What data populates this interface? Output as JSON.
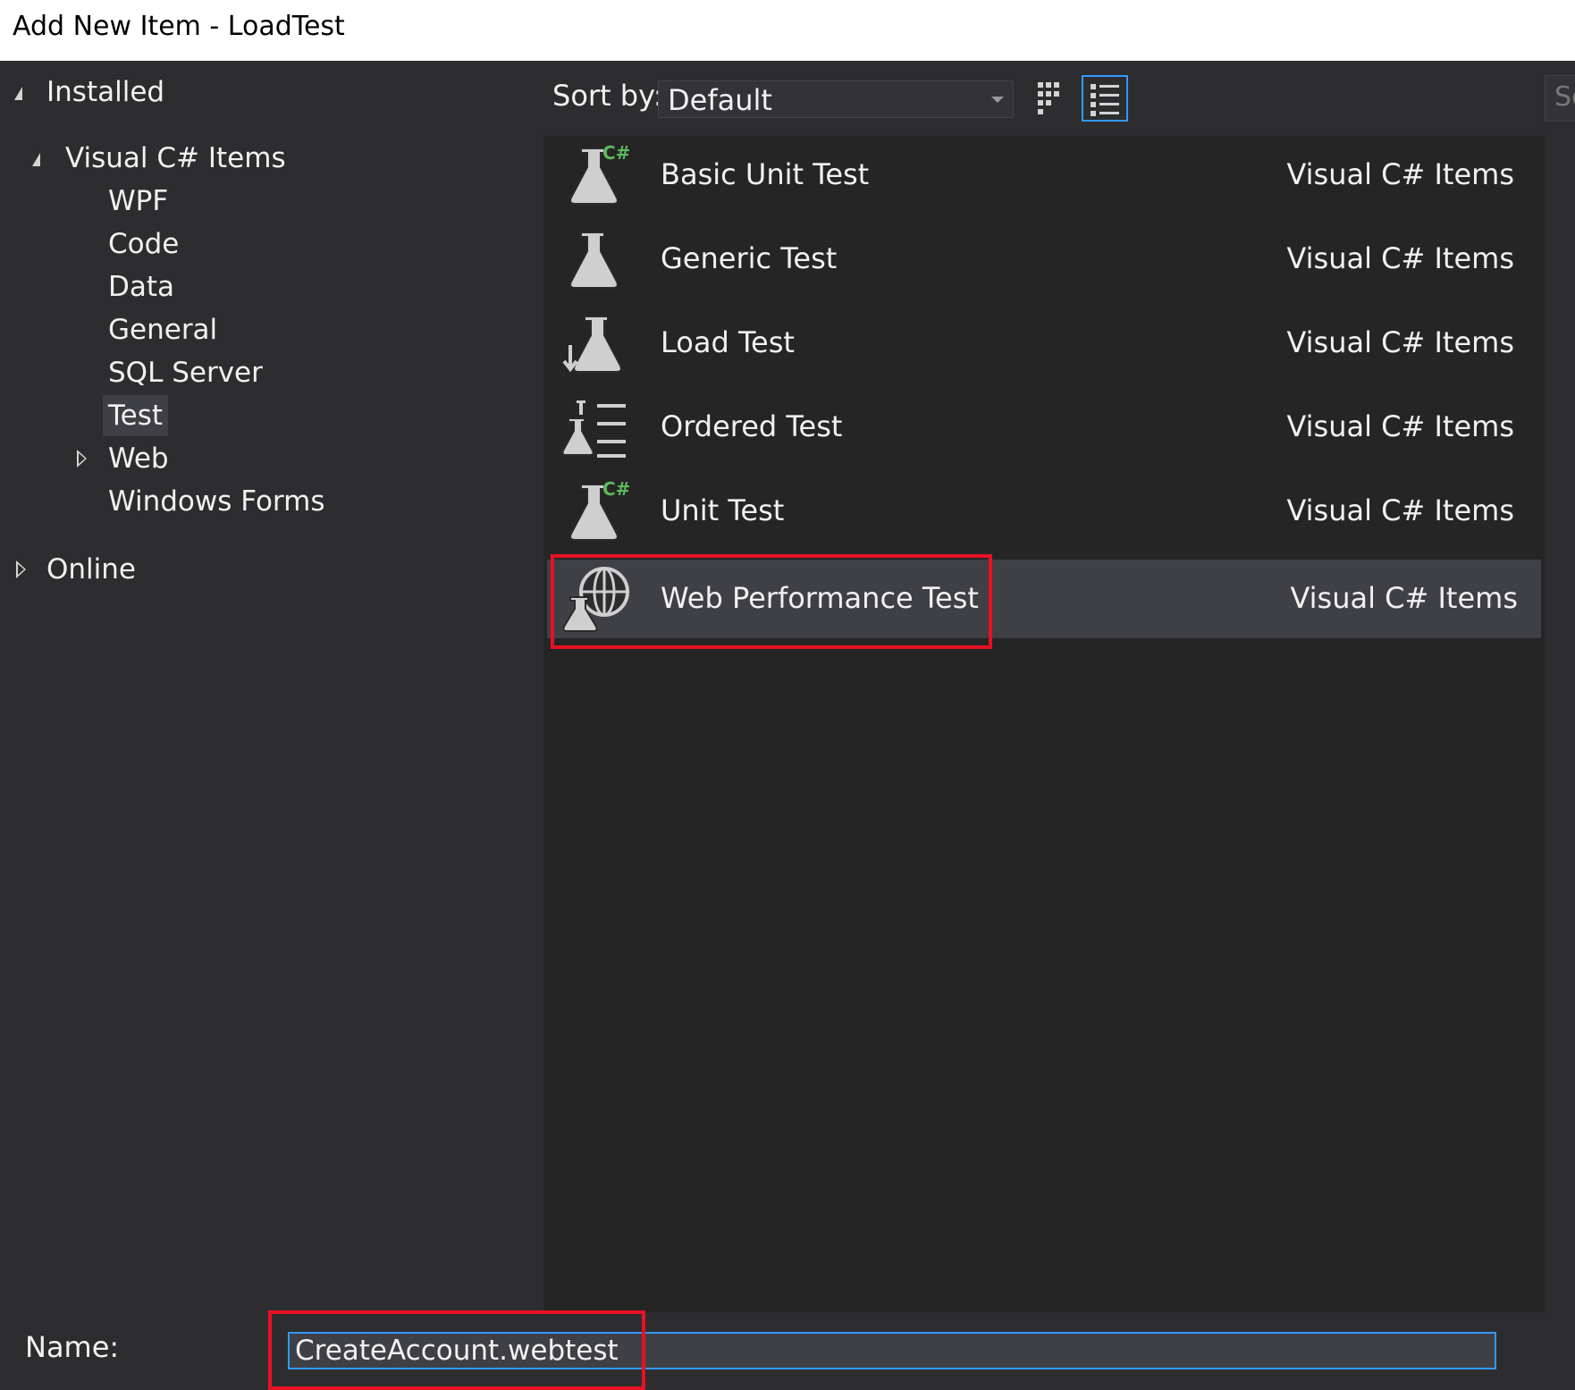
{
  "window": {
    "title": "Add New Item - LoadTest"
  },
  "tree": {
    "installed": "Installed",
    "visual_csharp": "Visual C# Items",
    "children": [
      "WPF",
      "Code",
      "Data",
      "General",
      "SQL Server",
      "Test",
      "Web",
      "Windows Forms"
    ],
    "selected": "Test",
    "online": "Online"
  },
  "toolbar": {
    "sort_label": "Sort by:",
    "sort_value": "Default",
    "search_partial": "Se"
  },
  "templates": [
    {
      "name": "Basic Unit Test",
      "category": "Visual C# Items",
      "icon": "flask-csharp-icon"
    },
    {
      "name": "Generic Test",
      "category": "Visual C# Items",
      "icon": "flask-icon"
    },
    {
      "name": "Load Test",
      "category": "Visual C# Items",
      "icon": "flask-load-icon"
    },
    {
      "name": "Ordered Test",
      "category": "Visual C# Items",
      "icon": "flask-ordered-icon"
    },
    {
      "name": "Unit Test",
      "category": "Visual C# Items",
      "icon": "flask-csharp-icon"
    },
    {
      "name": "Web Performance Test",
      "category": "Visual C# Items",
      "icon": "flask-globe-icon",
      "selected": true
    }
  ],
  "footer": {
    "name_label": "Name:",
    "name_value": "CreateAccount.webtest"
  },
  "colors": {
    "accent": "#3399ff",
    "highlight_annotation": "#e81123",
    "csharp_green": "#5db85c"
  }
}
